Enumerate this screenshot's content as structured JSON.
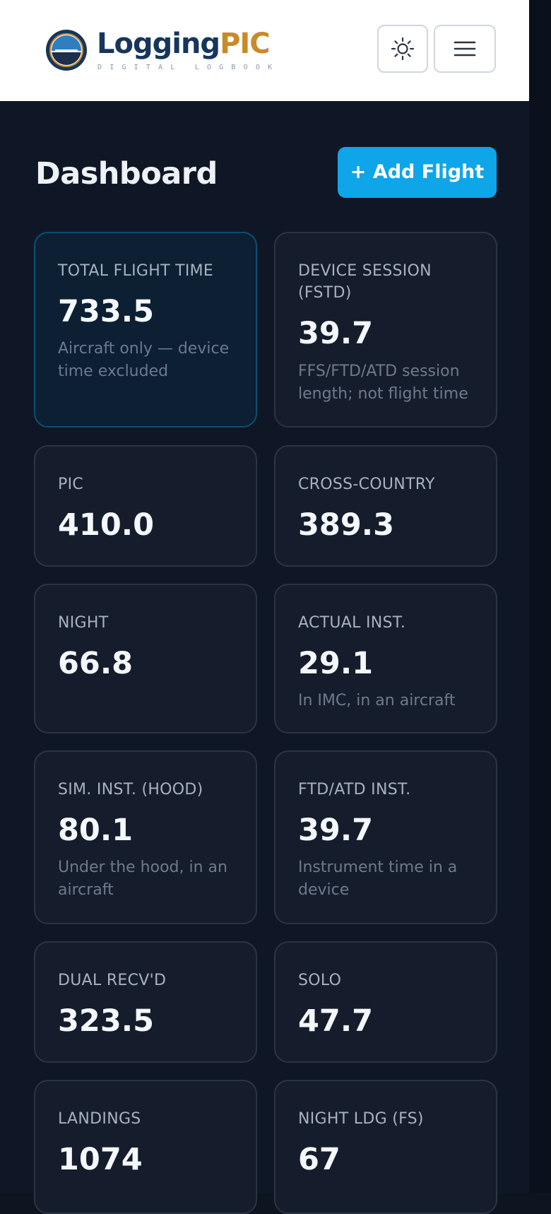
{
  "header": {
    "logo": {
      "name_part1": "Logging",
      "name_part2": "PIC",
      "tagline": "DIGITAL LOGBOOK"
    },
    "theme_toggle_icon": "sun-icon",
    "menu_icon": "hamburger-menu-icon"
  },
  "dashboard": {
    "title": "Dashboard",
    "add_flight_label": "+ Add Flight"
  },
  "stats": [
    {
      "label": "TOTAL FLIGHT TIME",
      "value": "733.5",
      "sub": "Aircraft only — device time excluded",
      "highlighted": true
    },
    {
      "label": "DEVICE SESSION (FSTD)",
      "value": "39.7",
      "sub": "FFS/FTD/ATD session length; not flight time"
    },
    {
      "label": "PIC",
      "value": "410.0",
      "sub": ""
    },
    {
      "label": "CROSS-COUNTRY",
      "value": "389.3",
      "sub": ""
    },
    {
      "label": "NIGHT",
      "value": "66.8",
      "sub": ""
    },
    {
      "label": "ACTUAL INST.",
      "value": "29.1",
      "sub": "In IMC, in an aircraft"
    },
    {
      "label": "SIM. INST. (HOOD)",
      "value": "80.1",
      "sub": "Under the hood, in an aircraft"
    },
    {
      "label": "FTD/ATD INST.",
      "value": "39.7",
      "sub": "Instrument time in a device"
    },
    {
      "label": "DUAL RECV'D",
      "value": "323.5",
      "sub": ""
    },
    {
      "label": "SOLO",
      "value": "47.7",
      "sub": ""
    },
    {
      "label": "LANDINGS",
      "value": "1074",
      "sub": ""
    },
    {
      "label": "NIGHT LDG (FS)",
      "value": "67",
      "sub": ""
    }
  ],
  "colors": {
    "background": "#0f1726",
    "card": "#151d2c",
    "accent": "#0ea5e9",
    "brand_navy": "#16365c",
    "brand_gold": "#c98a2a"
  }
}
